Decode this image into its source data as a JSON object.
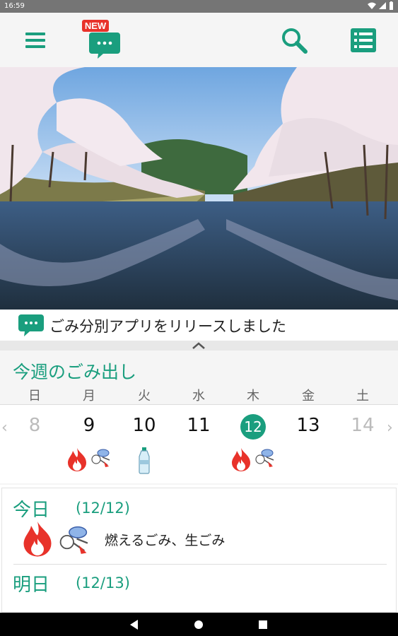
{
  "status_bar": {
    "time": "16:59"
  },
  "app_bar": {
    "menu_icon": "hamburger-menu-icon",
    "news_icon": "chat-bubble-icon",
    "new_badge": "NEW",
    "search_icon": "search-icon",
    "list_icon": "list-icon"
  },
  "hero": {
    "description": "cherry-blossom-river-photo"
  },
  "news": {
    "text": "ごみ分別アプリをリリースしました"
  },
  "week": {
    "title": "今週のごみ出し",
    "day_names": [
      "日",
      "月",
      "火",
      "水",
      "木",
      "金",
      "土"
    ],
    "dates": [
      "8",
      "9",
      "10",
      "11",
      "12",
      "13",
      "14"
    ],
    "today_index": 4
  },
  "today": {
    "label": "今日",
    "date": "(12/12)",
    "garbage": "燃えるごみ、生ごみ"
  },
  "tomorrow": {
    "label": "明日",
    "date": "(12/13)"
  },
  "colors": {
    "accent": "#1a9e7e",
    "burn": "#e8322a"
  }
}
